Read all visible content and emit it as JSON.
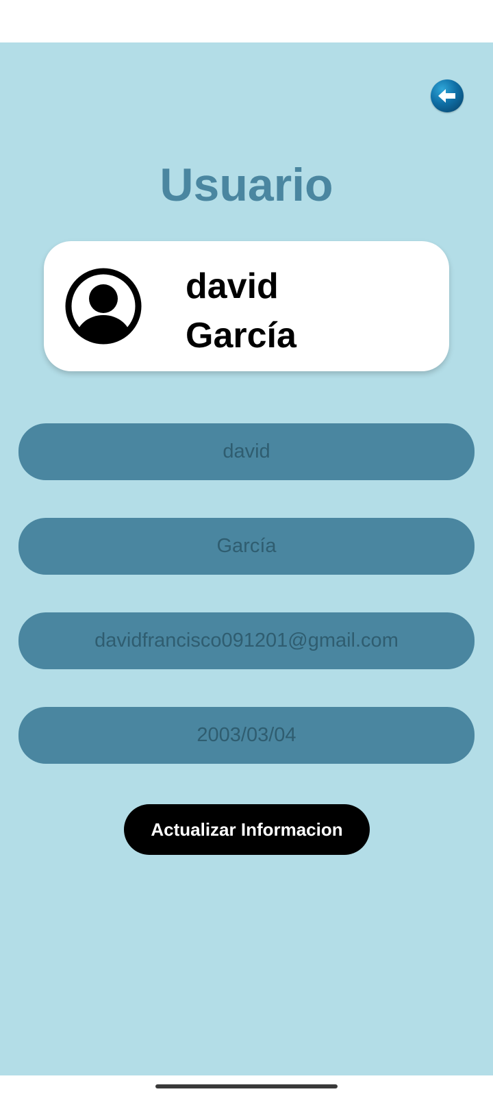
{
  "screen": {
    "title": "Usuario",
    "background_color": "#b3dde7",
    "accent_color": "#4a86a0"
  },
  "back_button": {
    "icon": "arrow-left-icon",
    "color": "#0f6fa6"
  },
  "profile_card": {
    "avatar_icon": "user-avatar-icon",
    "first_name": "david",
    "last_name": "García"
  },
  "form": {
    "first_name": "david",
    "last_name": "García",
    "email": "davidfrancisco091201@gmail.com",
    "birth_date": "2003/03/04"
  },
  "actions": {
    "update_label": "Actualizar Informacion"
  }
}
